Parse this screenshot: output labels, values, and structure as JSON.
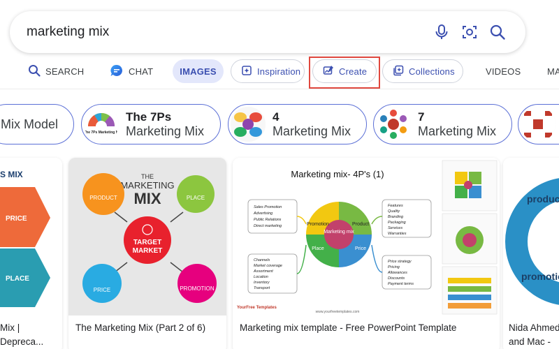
{
  "search": {
    "query": "marketing mix"
  },
  "nav": {
    "search": "SEARCH",
    "chat": "CHAT",
    "images": "IMAGES",
    "inspiration": "Inspiration",
    "create": "Create",
    "collections": "Collections",
    "videos": "VIDEOS",
    "more": "MA"
  },
  "chips": [
    {
      "line1": "",
      "line2": "Mix Model"
    },
    {
      "line1": "The 7Ps",
      "line2": "Marketing Mix",
      "thumb_text": "The 7Ps Marketing M"
    },
    {
      "line1": "4",
      "line2": "Marketing Mix"
    },
    {
      "line1": "7",
      "line2": "Marketing Mix"
    }
  ],
  "cards": [
    {
      "caption": "Mix | Depreca...",
      "thumb": {
        "title": "S MIX",
        "labels": [
          "PRICE",
          "PLACE"
        ]
      }
    },
    {
      "caption": "The Marketing Mix (Part 2 of 6)",
      "thumb": {
        "the": "THE",
        "marketing": "MARKETING",
        "mix": "MIX",
        "center1": "TARGET",
        "center2": "MARKET",
        "product": "PRODUCT",
        "place": "PLACE",
        "price": "PRICE",
        "promotion": "PROMOTION"
      }
    },
    {
      "caption": "Marketing mix template - Free PowerPoint Template",
      "thumb": {
        "title": "Marketing mix- 4P's (1)",
        "center": "Marketing mix",
        "quadrants": [
          "Promotion",
          "Product",
          "Place",
          "Price"
        ],
        "promo_items": [
          "Sales Promotion",
          "Advertising",
          "Public Relations",
          "Direct marketing"
        ],
        "product_items": [
          "Features",
          "Quality",
          "Branding",
          "Packaging",
          "Services",
          "Warranties"
        ],
        "place_items": [
          "Channels",
          "Market coverage",
          "Assortment",
          "Location",
          "Inventory",
          "Transport"
        ],
        "price_items": [
          "Price strategy",
          "Pricing",
          "Allowances",
          "Discounts",
          "Payment terms"
        ],
        "logo": "YourFree Templates",
        "url": "www.yourfreetemplates.com"
      }
    },
    {
      "caption": "Nida Ahmed and Mac - M...",
      "thumb": {
        "top": "product",
        "bottom": "promotio"
      }
    }
  ],
  "colors": {
    "accent": "#3b4fb0",
    "chip_border": "#5b6fd6",
    "highlight_frame": "#e0473e",
    "active_tab_bg": "#e3e7fb"
  },
  "icons": {
    "search": "magnifier-icon",
    "chat": "chat-bubble-icon",
    "inspiration": "sparkle-icon",
    "create": "image-create-icon",
    "collections": "collections-icon",
    "mic": "microphone-icon",
    "visual_search": "visual-search-icon"
  }
}
